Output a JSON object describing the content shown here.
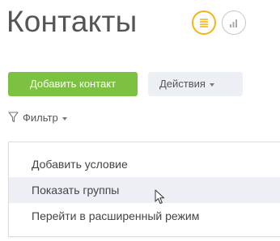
{
  "header": {
    "title": "Контакты",
    "view_buttons": [
      {
        "icon": "list-icon",
        "active": true
      },
      {
        "icon": "bar-chart-icon",
        "active": false
      }
    ]
  },
  "toolbar": {
    "add_label": "Добавить контакт",
    "actions_label": "Действия"
  },
  "filter": {
    "label": "Фильтр"
  },
  "filter_menu": {
    "items": [
      {
        "label": "Добавить условие",
        "hovered": false
      },
      {
        "label": "Показать группы",
        "hovered": true
      },
      {
        "label": "Перейти в расширенный режим",
        "hovered": false
      }
    ]
  },
  "colors": {
    "accent_green": "#7dc142",
    "active_ring": "#f5b318",
    "hover_bg": "#eceff3"
  }
}
